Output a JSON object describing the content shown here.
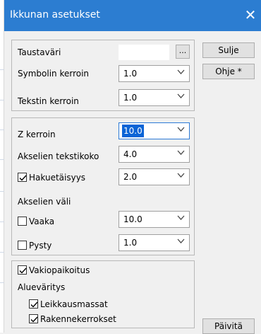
{
  "window": {
    "title": "Ikkunan asetukset",
    "close_glyph": "✕"
  },
  "group1": {
    "background_label": "Taustaväri",
    "browse_label": "...",
    "symbol_label": "Symbolin kerroin",
    "symbol_value": "1.0",
    "text_label": "Tekstin kerroin",
    "text_value": "1.0"
  },
  "group2": {
    "z_label": "Z kerroin",
    "z_value": "10.0",
    "axis_text_label": "Akselien tekstikoko",
    "axis_text_value": "4.0",
    "search_label": "Hakuetäisyys",
    "search_checked": true,
    "search_value": "2.0",
    "axis_spacing_label": "Akselien väli",
    "horizontal_label": "Vaaka",
    "horizontal_checked": false,
    "horizontal_value": "10.0",
    "vertical_label": "Pysty",
    "vertical_checked": false,
    "vertical_value": "1.0"
  },
  "group3": {
    "default_pos_label": "Vakiopaikoitus",
    "default_pos_checked": true,
    "area_color_label": "Alueväritys",
    "cut_masses_label": "Leikkausmassat",
    "cut_masses_checked": true,
    "structure_layers_label": "Rakennekerrokset",
    "structure_layers_checked": true
  },
  "buttons": {
    "close": "Sulje",
    "help": "Ohje *",
    "update": "Päivitä"
  },
  "colors": {
    "titlebar": "#2c7dd1",
    "focus_highlight": "#0a64d6"
  }
}
